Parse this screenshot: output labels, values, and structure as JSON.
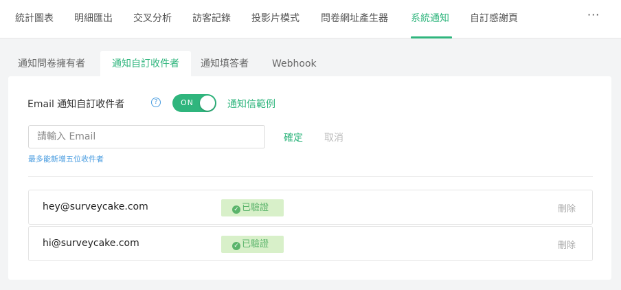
{
  "topnav": {
    "tabs": [
      {
        "label": "統計圖表"
      },
      {
        "label": "明細匯出"
      },
      {
        "label": "交叉分析"
      },
      {
        "label": "訪客記錄"
      },
      {
        "label": "投影片模式"
      },
      {
        "label": "問卷網址產生器"
      },
      {
        "label": "系統通知"
      },
      {
        "label": "自訂感謝頁"
      }
    ],
    "active_index": 6,
    "more_label": "···"
  },
  "subtabs": {
    "items": [
      {
        "label": "通知問卷擁有者"
      },
      {
        "label": "通知自訂收件者"
      },
      {
        "label": "通知填答者"
      },
      {
        "label": "Webhook"
      }
    ],
    "active_index": 1
  },
  "settings": {
    "email_label": "Email 通知自訂收件者",
    "help_icon": "?",
    "toggle_label": "ON",
    "toggle_state": "on",
    "sample_link": "通知信範例"
  },
  "add_form": {
    "placeholder": "請輸入 Email",
    "value": "",
    "confirm_label": "確定",
    "cancel_label": "取消",
    "hint": "最多能新增五位收件者"
  },
  "recipients": [
    {
      "email": "hey@surveycake.com",
      "status": "已驗證",
      "delete_label": "刪除"
    },
    {
      "email": "hi@surveycake.com",
      "status": "已驗證",
      "delete_label": "刪除"
    }
  ],
  "colors": {
    "accent": "#2fb57d",
    "link": "#4a9de0",
    "verified_bg": "#d8f0c9",
    "verified_text": "#5bb46b"
  }
}
